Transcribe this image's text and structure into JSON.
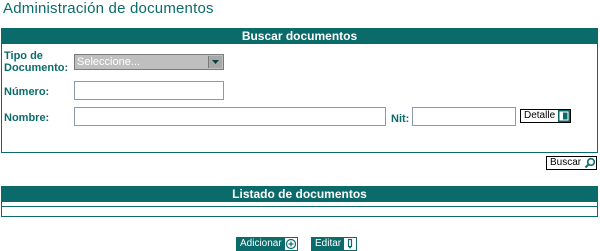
{
  "page": {
    "title": "Administración de documentos"
  },
  "search": {
    "header": "Buscar documentos",
    "tipo_label_line1": "Tipo de",
    "tipo_label_line2": "Documento:",
    "tipo_selected": "Seleccione...",
    "numero_label": "Número:",
    "numero_value": "",
    "nombre_label": "Nombre:",
    "nombre_value": "",
    "nit_label": "Nit:",
    "nit_value": "",
    "detalle_label": "Detalle",
    "buscar_label": "Buscar"
  },
  "list": {
    "header": "Listado de documentos"
  },
  "actions": {
    "adicionar_label": "Adicionar",
    "editar_label": "Editar"
  },
  "colors": {
    "accent": "#0b6b6b"
  }
}
